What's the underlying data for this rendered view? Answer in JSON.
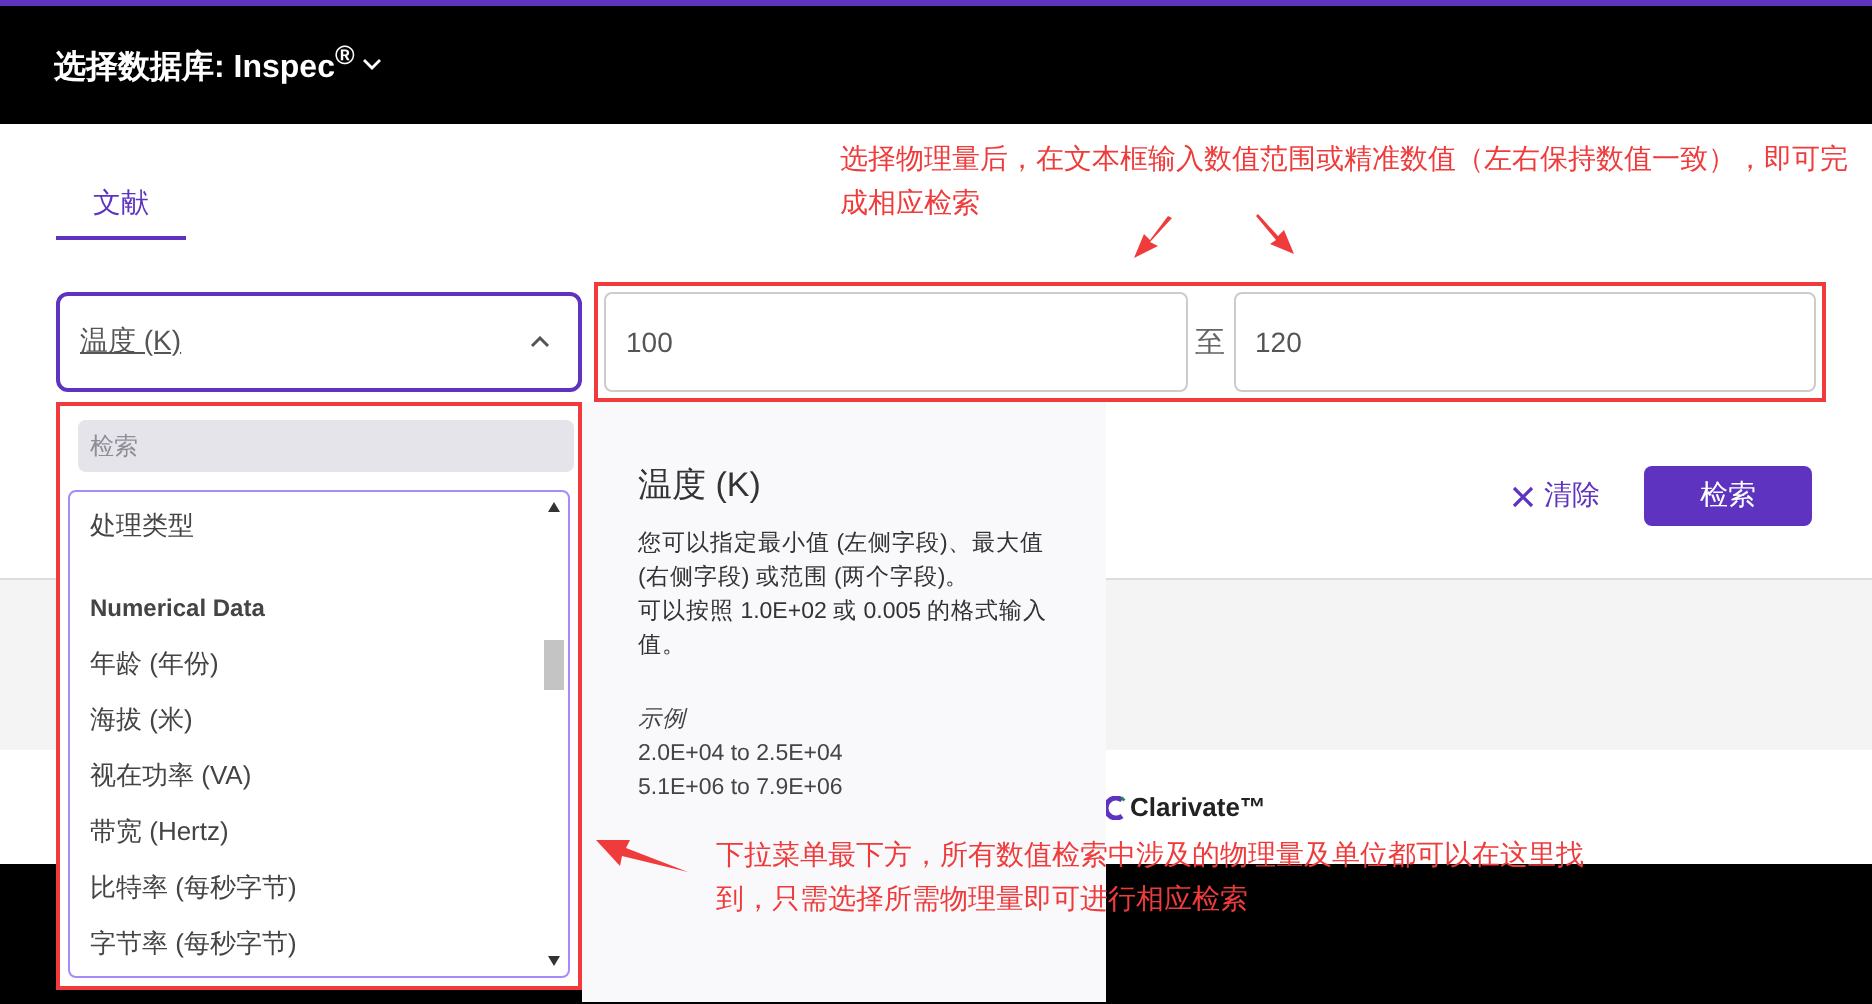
{
  "header": {
    "title": "选择数据库: Inspec$^{®}$"
  },
  "tabs": [
    {
      "label": "文献",
      "selected": true
    }
  ],
  "field_select": {
    "value": "温度 (K)",
    "expanded": true
  },
  "range": {
    "from": "100",
    "separator": "至",
    "to": "120"
  },
  "buttons": {
    "clear": "清除",
    "search": "检索"
  },
  "dropdown": {
    "search_placeholder": "检索",
    "items": [
      {
        "kind": "option",
        "label": "处理类型"
      },
      {
        "kind": "heading",
        "label": "Numerical Data"
      },
      {
        "kind": "option",
        "label": "年龄 (年份)"
      },
      {
        "kind": "option",
        "label": "海拔 (米)"
      },
      {
        "kind": "option",
        "label": "视在功率 (VA)"
      },
      {
        "kind": "option",
        "label": "带宽 (Hertz)"
      },
      {
        "kind": "option",
        "label": "比特率 (每秒字节)"
      },
      {
        "kind": "option",
        "label": "字节率 (每秒字节)"
      }
    ]
  },
  "info": {
    "title": "温度 (K)",
    "description": [
      "您可以指定最小值 (左侧字段)、最大值 (右侧字段) 或范围 (两个字段)。",
      "可以按照 1.0E+02 或 0.005 的格式输入值。"
    ],
    "example_label": "示例",
    "examples": [
      "2.0E+04 to 2.5E+04",
      "5.1E+06 to 7.9E+06"
    ]
  },
  "footer": {
    "logo": "Clarivate™"
  },
  "annotations": [
    {
      "text": "选择物理量后，在文本框输入数值范围或精准数值（左右保持数值一致），即可完成相应检索"
    },
    {
      "text": "下拉菜单最下方，所有数值检索中涉及的物理量及单位都可以在这里找到，只需选择所需物理量即可进行相应检索"
    }
  ]
}
